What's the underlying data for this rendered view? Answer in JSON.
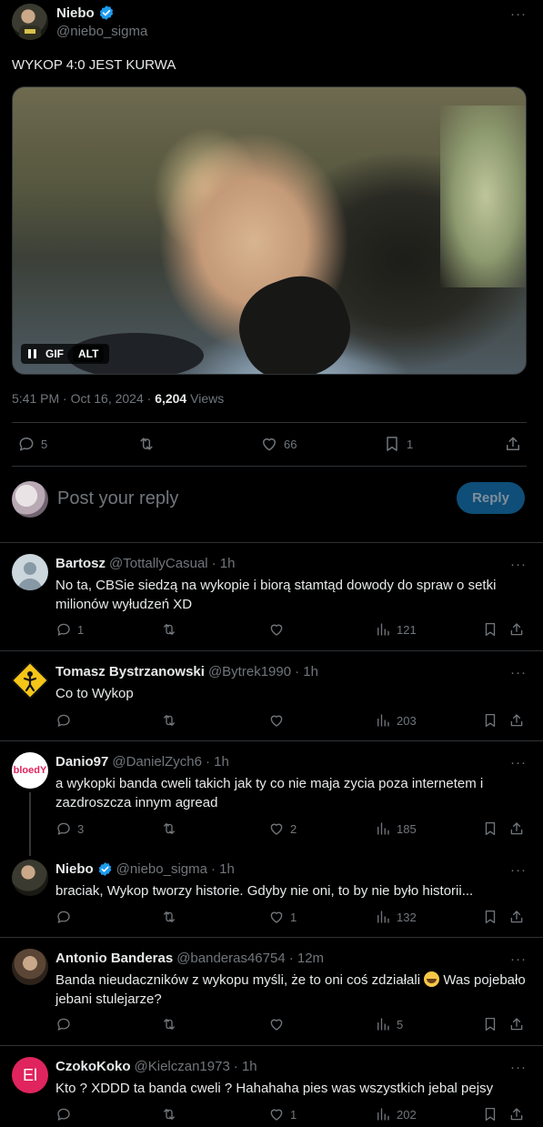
{
  "main_tweet": {
    "name": "Niebo",
    "handle": "@niebo_sigma",
    "text": "WYKOP 4:0 JEST KURWA",
    "media": {
      "gif_label": "GIF",
      "alt_label": "ALT"
    },
    "time": "5:41 PM · Oct 16, 2024 · ",
    "views_count": "6,204",
    "views_label": " Views",
    "actions": {
      "replies": "5",
      "reposts": "",
      "likes": "66",
      "bookmarks": "1"
    }
  },
  "composer": {
    "placeholder": "Post your reply",
    "button": "Reply"
  },
  "replies": [
    {
      "name": "Bartosz",
      "verified": false,
      "handle": "@TottallyCasual",
      "time": "· 1h",
      "text": "No ta, CBSie siedzą na wykopie i biorą stamtąd dowody do spraw o setki milionów wyłudzeń XD",
      "replies": "1",
      "reposts": "",
      "likes": "",
      "views": "121"
    },
    {
      "name": "Tomasz Bystrzanowski",
      "verified": false,
      "handle": "@Bytrek1990",
      "time": "· 1h",
      "text": "Co to Wykop",
      "replies": "",
      "reposts": "",
      "likes": "",
      "views": "203"
    },
    {
      "name": "Danio97",
      "verified": false,
      "handle": "@DanielZych6",
      "time": "· 1h",
      "text": "a wykopki banda cweli takich jak ty co nie maja zycia poza internetem i zazdroszcza innym agread",
      "avatar_text": "bloedY",
      "replies": "3",
      "reposts": "",
      "likes": "2",
      "views": "185"
    },
    {
      "name": "Niebo",
      "verified": true,
      "handle": "@niebo_sigma",
      "time": "· 1h",
      "text": "braciak, Wykop tworzy historie. Gdyby nie oni, to by nie było historii...",
      "replies": "",
      "reposts": "",
      "likes": "1",
      "views": "132"
    },
    {
      "name": "Antonio Banderas",
      "verified": false,
      "handle": "@banderas46754",
      "time": "· 12m",
      "text_a": "Banda nieudaczników z wykopu myśli, że to oni coś zdziałali ",
      "text_b": " Was pojebało jebani stulejarze?",
      "replies": "",
      "reposts": "",
      "likes": "",
      "views": "5"
    },
    {
      "name": "CzokoKoko",
      "verified": false,
      "handle": "@Kielczan1973",
      "time": "· 1h",
      "text": "Kto ? XDDD ta banda cweli ? Hahahaha pies was wszystkich jebal pejsy",
      "avatar_text": "El",
      "replies": "",
      "reposts": "",
      "likes": "1",
      "views": "202"
    }
  ],
  "colors": {
    "accent": "#1d9bf0",
    "muted": "#71767b",
    "divider": "#2f3336",
    "reply_button": "#0f4e78",
    "czoko_avatar": "#e0245e"
  }
}
